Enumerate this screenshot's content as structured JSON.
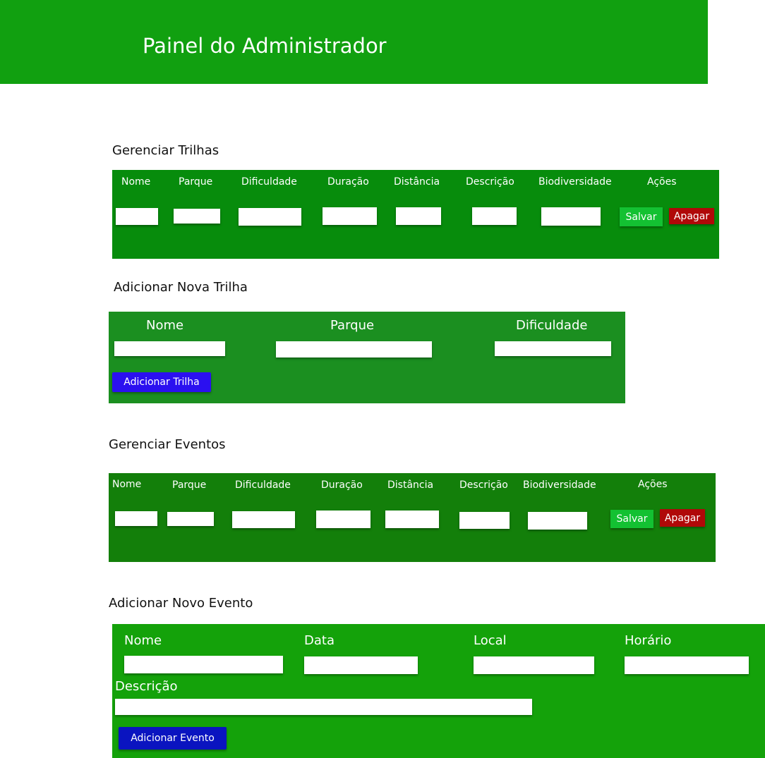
{
  "header": {
    "title": "Painel do Administrador"
  },
  "colors": {
    "header_bg": "#11a010",
    "trails_table_bg": "#078c0c",
    "add_trail_bg": "#1b8f20",
    "events_table_bg": "#137f0a",
    "add_event_bg": "#14a20a",
    "save_button": "#13c132",
    "delete_button": "#b00808",
    "add_trail_button": "#2b10f0",
    "add_event_button": "#0a14c0"
  },
  "manage_trails": {
    "title": "Gerenciar Trilhas",
    "columns": [
      "Nome",
      "Parque",
      "Dificuldade",
      "Duração",
      "Distância",
      "Descrição",
      "Biodiversidade",
      "Ações"
    ],
    "save_label": "Salvar",
    "delete_label": "Apagar"
  },
  "add_trail": {
    "title": "Adicionar Nova Trilha",
    "fields": [
      "Nome",
      "Parque",
      "Dificuldade"
    ],
    "button_label": "Adicionar Trilha"
  },
  "manage_events": {
    "title": "Gerenciar Eventos",
    "columns": [
      "Nome",
      "Parque",
      "Dificuldade",
      "Duração",
      "Distância",
      "Descrição",
      "Biodiversidade",
      "Ações"
    ],
    "save_label": "Salvar",
    "delete_label": "Apagar"
  },
  "add_event": {
    "title": "Adicionar Novo Evento",
    "fields": [
      "Nome",
      "Data",
      "Local",
      "Horário"
    ],
    "description_label": "Descrição",
    "button_label": "Adicionar Evento"
  }
}
